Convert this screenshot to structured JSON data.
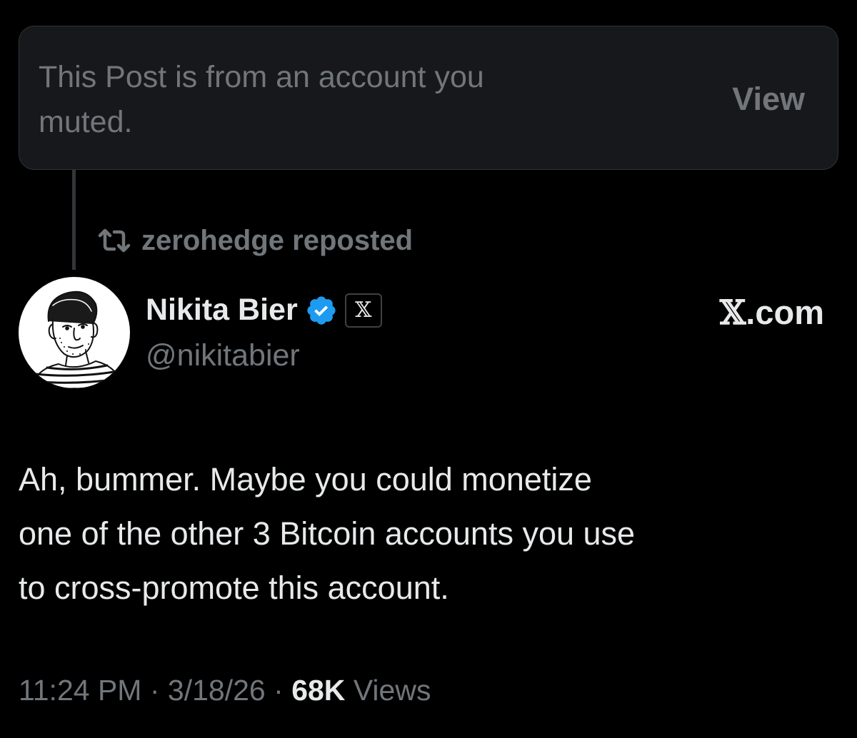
{
  "muted_card": {
    "line_1": "This Post is from an account you",
    "line_2": "muted.",
    "view_label": "View"
  },
  "repost": {
    "icon": "repost-icon",
    "text": "zerohedge reposted"
  },
  "author": {
    "display_name": "Nikita Bier",
    "handle": "@nikitabier",
    "verified_color": "#1d9bf0",
    "affiliate_badge": "𝕏",
    "source_prefix": "𝕏",
    "source_suffix": ".com"
  },
  "tweet": {
    "line_1": "Ah, bummer. Maybe you could monetize",
    "line_2": "one of the other 3 Bitcoin accounts you use",
    "line_3": "to cross-promote this account."
  },
  "meta": {
    "time": "11:24 PM",
    "separator": "·",
    "date": "3/18/26",
    "views_count": "68K",
    "views_label": "Views"
  }
}
